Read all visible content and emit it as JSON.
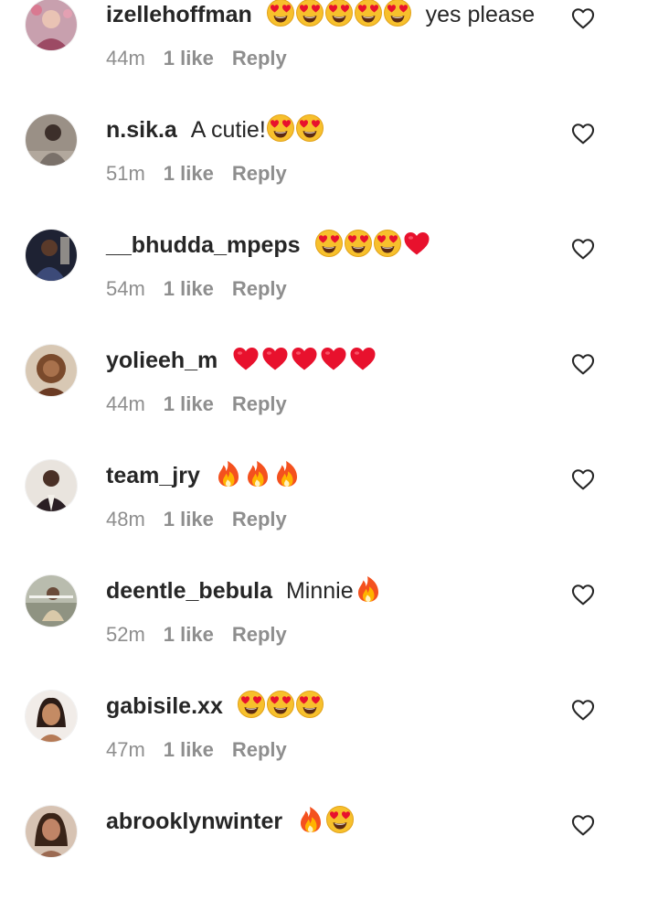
{
  "comments": [
    {
      "username": "izellehoffman",
      "text": "yes please",
      "emoji_before": "😍😍😍😍😍",
      "emoji_after": "",
      "time": "44m",
      "likes": "1 like",
      "reply": "Reply",
      "avatar_color": "#b46c7c"
    },
    {
      "username": "n.sik.a",
      "text": "A cutie!",
      "emoji_before": "",
      "emoji_after": "😍😍",
      "time": "51m",
      "likes": "1 like",
      "reply": "Reply",
      "avatar_color": "#5d5750"
    },
    {
      "username": "__bhudda_mpeps",
      "text": "",
      "emoji_before": "😍😍😍❤️",
      "emoji_after": "",
      "time": "54m",
      "likes": "1 like",
      "reply": "Reply",
      "avatar_color": "#2f3448"
    },
    {
      "username": "yolieeh_m",
      "text": "",
      "emoji_before": "❤️❤️❤️❤️❤️",
      "emoji_after": "",
      "time": "44m",
      "likes": "1 like",
      "reply": "Reply",
      "avatar_color": "#8a5a3c"
    },
    {
      "username": "team_jry",
      "text": "",
      "emoji_before": "🔥🔥🔥",
      "emoji_after": "",
      "time": "48m",
      "likes": "1 like",
      "reply": "Reply",
      "avatar_color": "#3a2f30"
    },
    {
      "username": "deentle_bebula",
      "text": "Minnie",
      "emoji_before": "",
      "emoji_after": "🔥",
      "time": "52m",
      "likes": "1 like",
      "reply": "Reply",
      "avatar_color": "#7b7d6e"
    },
    {
      "username": "gabisile.xx",
      "text": "",
      "emoji_before": "😍😍😍",
      "emoji_after": "",
      "time": "47m",
      "likes": "1 like",
      "reply": "Reply",
      "avatar_color": "#c89b7b"
    },
    {
      "username": "abrooklynwinter",
      "text": "",
      "emoji_before": "🔥😍",
      "emoji_after": "",
      "time": "",
      "likes": "",
      "reply": "",
      "avatar_color": "#6a4a3a"
    }
  ],
  "icons": {
    "like": "heart-outline-icon",
    "hearteyes": "heart-eyes-emoji",
    "redheart": "red-heart-emoji",
    "fire": "fire-emoji"
  },
  "colors": {
    "text": "#262626",
    "meta": "#8e8e8e",
    "heart_red": "#e8112d",
    "emoji_yellow": "#f7c02c"
  }
}
